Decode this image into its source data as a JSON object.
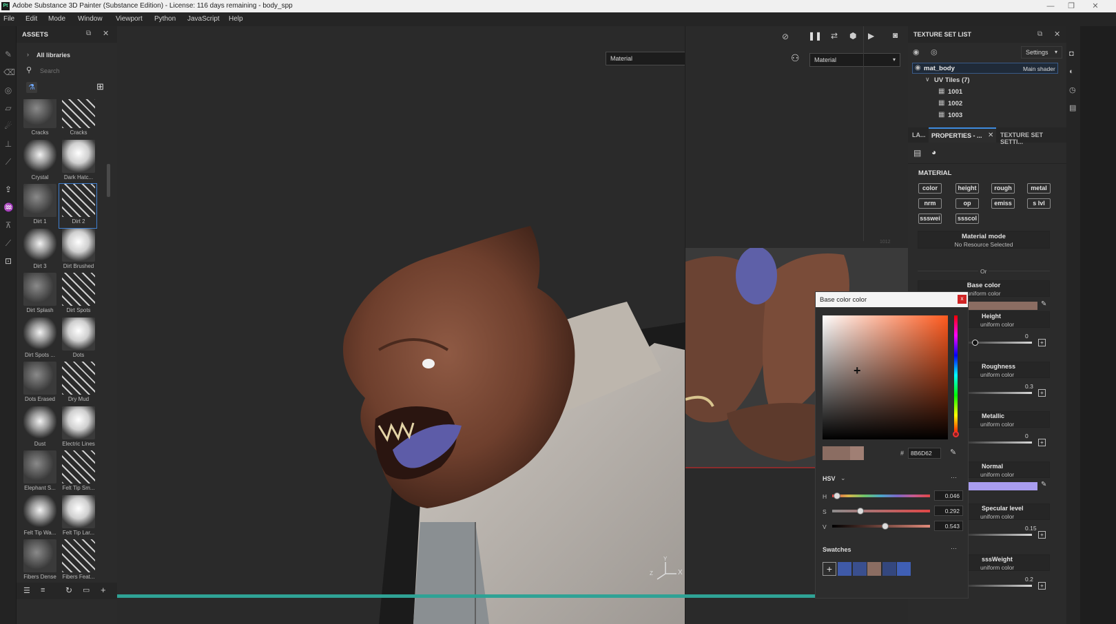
{
  "window": {
    "title": "Adobe Substance 3D Painter (Substance Edition) - License: 116 days remaining - body_spp",
    "app_icon": "Pt",
    "minimize": "—",
    "maximize": "❐",
    "close": "✕"
  },
  "menu": [
    "File",
    "Edit",
    "Mode",
    "Window",
    "Viewport",
    "Python",
    "JavaScript",
    "Help"
  ],
  "assets": {
    "title": "ASSETS",
    "library": "All libraries",
    "search_placeholder": "Search",
    "items": [
      {
        "label": "Cracks"
      },
      {
        "label": "Cracks"
      },
      {
        "label": "Crystal"
      },
      {
        "label": "Dark Hatc..."
      },
      {
        "label": "Dirt 1"
      },
      {
        "label": "Dirt 2"
      },
      {
        "label": "Dirt 3"
      },
      {
        "label": "Dirt Brushed"
      },
      {
        "label": "Dirt Splash"
      },
      {
        "label": "Dirt Spots"
      },
      {
        "label": "Dirt Spots ..."
      },
      {
        "label": "Dots"
      },
      {
        "label": "Dots Erased"
      },
      {
        "label": "Dry Mud"
      },
      {
        "label": "Dust"
      },
      {
        "label": "Electric Lines"
      },
      {
        "label": "Elephant S..."
      },
      {
        "label": "Felt Tip Sm..."
      },
      {
        "label": "Felt Tip Wa..."
      },
      {
        "label": "Felt Tip Lar..."
      },
      {
        "label": "Fibers Dense"
      },
      {
        "label": "Fibers Feat..."
      }
    ],
    "selected": "Dirt 2"
  },
  "viewport": {
    "mode_3d": "Material",
    "mode_2d": "Material",
    "tile_label": "1012",
    "axis_x": "X",
    "axis_y": "Y",
    "axis_z": "Z"
  },
  "texture_set_list": {
    "title": "TEXTURE SET LIST",
    "settings": "Settings",
    "mat_name": "mat_body",
    "shader": "Main shader",
    "uv_tiles": "UV Tiles (7)",
    "tiles": [
      "1001",
      "1002",
      "1003"
    ]
  },
  "tabs": {
    "layers": "LA...",
    "properties": "PROPERTIES - ...",
    "texture_set_settings": "TEXTURE SET SETTI..."
  },
  "properties": {
    "section": "MATERIAL",
    "chips": [
      "color",
      "height",
      "rough",
      "metal",
      "nrm",
      "op",
      "emiss",
      "s lvl",
      "ssswei",
      "ssscol"
    ],
    "material_mode": "Material mode",
    "no_resource": "No Resource Selected",
    "or": "Or",
    "base_color_title": "Base color",
    "channels": [
      {
        "title": "Height",
        "sub": "uniform color",
        "value": "0"
      },
      {
        "title": "Roughness",
        "sub": "uniform color",
        "value": "0.3"
      },
      {
        "title": "Metallic",
        "sub": "uniform color",
        "value": "0"
      },
      {
        "title": "Normal",
        "sub": "uniform color",
        "value": ""
      },
      {
        "title": "Specular level",
        "sub": "uniform color",
        "value": "0.15"
      },
      {
        "title": "sssWeight",
        "sub": "uniform color",
        "value": "0.2"
      }
    ],
    "uniform_color": "uniform color",
    "base_swatch_color": "#8b6d62",
    "normal_swatch_color": "#a99df0"
  },
  "color_picker": {
    "title": "Base color color",
    "close": "x",
    "hash": "#",
    "hex": "8B6D62",
    "model": "HSV",
    "h_label": "H",
    "h_value": "0.046",
    "h_level": 0.046,
    "s_label": "S",
    "s_value": "0.292",
    "s_level": 0.292,
    "v_label": "V",
    "v_value": "0.543",
    "v_level": 0.543,
    "swatches_title": "Swatches",
    "add": "+",
    "swatches": [
      "#3f5aa8",
      "#3a4f8e",
      "#8b6d62",
      "#34477e",
      "#3f5fb5"
    ],
    "current_color": "#8b6d62",
    "previous_color": "#a07f74"
  }
}
